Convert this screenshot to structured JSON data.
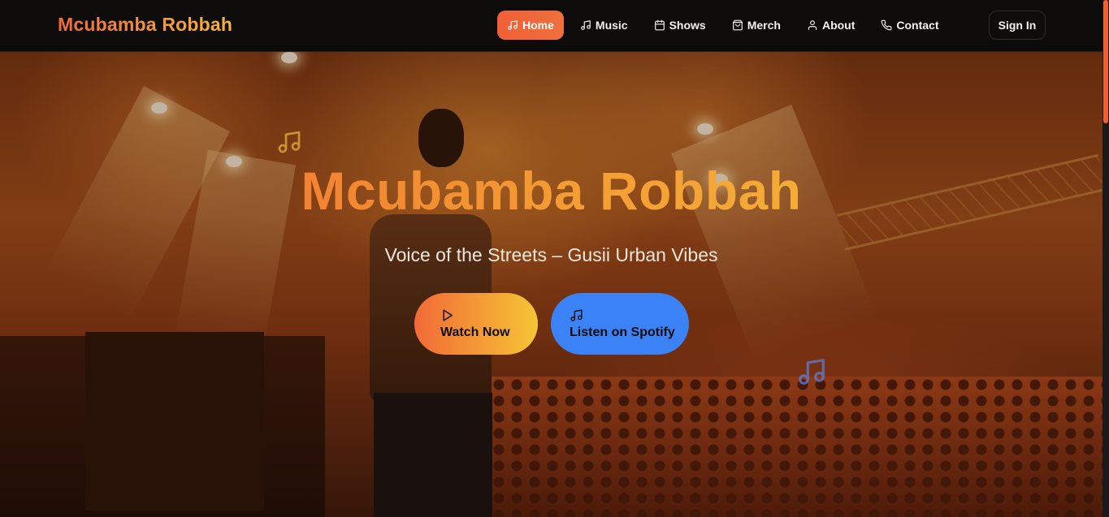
{
  "header": {
    "brand": "Mcubamba Robbah",
    "nav": [
      {
        "label": "Home",
        "icon": "music-note-icon",
        "active": true
      },
      {
        "label": "Music",
        "icon": "music-note-icon",
        "active": false
      },
      {
        "label": "Shows",
        "icon": "calendar-icon",
        "active": false
      },
      {
        "label": "Merch",
        "icon": "shopping-bag-icon",
        "active": false
      },
      {
        "label": "About",
        "icon": "user-icon",
        "active": false
      },
      {
        "label": "Contact",
        "icon": "phone-icon",
        "active": false
      }
    ],
    "signin_label": "Sign In"
  },
  "hero": {
    "title": "Mcubamba Robbah",
    "subtitle": "Voice of the Streets – Gusii Urban Vibes",
    "watch_label": "Watch Now",
    "spotify_label": "Listen on Spotify",
    "watch_icon": "play-icon",
    "spotify_icon": "music-note-icon"
  },
  "colors": {
    "accent_orange": "#f05f32",
    "accent_yellow": "#f7c13a",
    "spotify_blue": "#3b82f6",
    "header_bg": "#0d0c0b"
  }
}
